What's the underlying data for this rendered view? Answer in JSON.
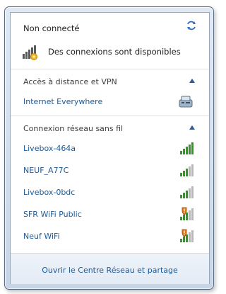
{
  "header": {
    "title": "Non connecté",
    "status_text": "Des connexions sont disponibles",
    "refresh_icon": "refresh-arrows-icon",
    "status_icon": "network-available-icon"
  },
  "sections": [
    {
      "title": "Accès à distance et VPN",
      "items": [
        {
          "name": "Internet Everywhere",
          "icon": "dialup-modem-icon"
        }
      ]
    },
    {
      "title": "Connexion réseau sans fil",
      "items": [
        {
          "name": "Livebox-464a",
          "signal": 5,
          "secured": true
        },
        {
          "name": "NEUF_A77C",
          "signal": 3,
          "secured": true
        },
        {
          "name": "Livebox-0bdc",
          "signal": 3,
          "secured": true
        },
        {
          "name": "SFR WiFi Public",
          "signal": 3,
          "secured": false
        },
        {
          "name": "Neuf WiFi",
          "signal": 3,
          "secured": false
        }
      ]
    }
  ],
  "footer": {
    "link": "Ouvrir le Centre Réseau et partage"
  },
  "colors": {
    "link": "#1a5a9a",
    "signal_green": "#2e9a22",
    "signal_grey": "#b8b8b8",
    "warning_orange": "#e07b17"
  }
}
